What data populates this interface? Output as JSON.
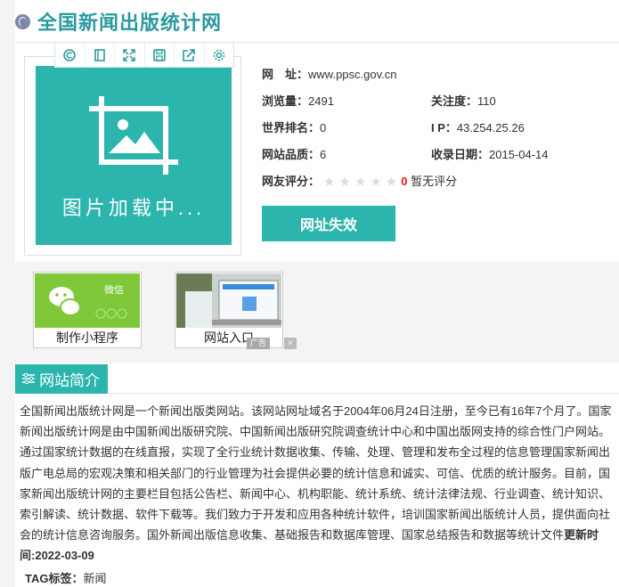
{
  "site": {
    "title": "全国新闻出版统计网"
  },
  "thumbnail": {
    "loading_text": "图片加载中..."
  },
  "toolbar_icons": [
    "copy-icon",
    "bookmark-icon",
    "fullscreen-icon",
    "save-icon",
    "share-icon",
    "settings-icon"
  ],
  "info": {
    "url_label": "网　址：",
    "url_value": "www.ppsc.gov.cn",
    "views_label": "浏览量：",
    "views_value": "2491",
    "follow_label": "关注度：",
    "follow_value": "110",
    "rank_label": "世界排名：",
    "rank_value": "0",
    "ip_label": "I P：",
    "ip_value": "43.254.25.26",
    "quality_label": "网站品质：",
    "quality_value": "6",
    "date_label": "收录日期：",
    "date_value": "2015-04-14",
    "rating_label": "网友评分：",
    "rating_value": "0",
    "rating_text": "暂无评分",
    "stars": 0
  },
  "buttons": {
    "invalid": "网址失效"
  },
  "ads": {
    "items": [
      {
        "label": "制作小程序",
        "img_text": "微信"
      },
      {
        "label": "网站入口"
      }
    ],
    "tag": "广告",
    "close": "×"
  },
  "intro": {
    "heading": "网站简介",
    "body": "全国新闻出版统计网是一个新闻出版类网站。该网站网址域名于2004年06月24日注册，至今已有16年7个月了。国家新闻出版统计网是由中国新闻出版研究院、中国新闻出版研究院调查统计中心和中国出版网支持的综合性门户网站。通过国家统计数据的在线直报，实现了全行业统计数据收集、传输、处理、管理和发布全过程的信息管理国家新闻出版广电总局的宏观决策和相关部门的行业管理为社会提供必要的统计信息和诚实、可信、优质的统计服务。目前，国家新闻出版统计网的主要栏目包括公告栏、新闻中心、机构职能、统计系统、统计法律法规、行业调查、统计知识、索引解读、统计数据、软件下载等。我们致力于开发和应用各种统计软件，培训国家新闻出版统计人员，提供面向社会的统计信息咨询服务。国外新闻出版信息收集、基础报告和数据库管理、国家总结报告和数据等统计文件",
    "updated_label": "更新时间:",
    "updated_value": "2022-03-09"
  },
  "tags": {
    "label": "TAG标签：",
    "value": "新闻"
  },
  "colors": {
    "accent": "#2bb5ad",
    "title": "#2a9aa0",
    "red": "#ee1111"
  }
}
